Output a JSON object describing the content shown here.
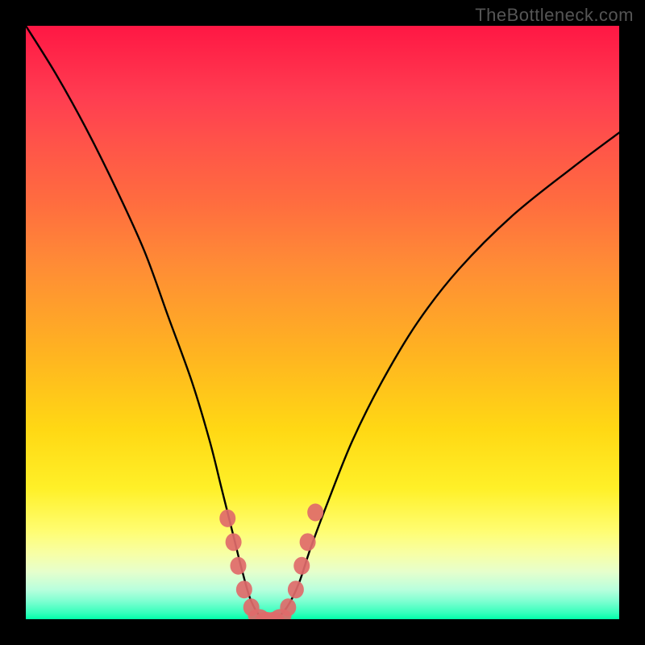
{
  "watermark": {
    "text": "TheBottleneck.com"
  },
  "chart_data": {
    "type": "line",
    "title": "",
    "xlabel": "",
    "ylabel": "",
    "xlim": [
      0,
      100
    ],
    "ylim": [
      0,
      100
    ],
    "legend": false,
    "grid": false,
    "background": "heatmap-gradient",
    "gradient_stops": [
      {
        "pos": 0.0,
        "color": "#ff1744"
      },
      {
        "pos": 0.2,
        "color": "#ff5449"
      },
      {
        "pos": 0.4,
        "color": "#ff8b36"
      },
      {
        "pos": 0.6,
        "color": "#ffc51c"
      },
      {
        "pos": 0.8,
        "color": "#fff44a"
      },
      {
        "pos": 0.93,
        "color": "#d9ffc8"
      },
      {
        "pos": 1.0,
        "color": "#00ffa8"
      }
    ],
    "series": [
      {
        "name": "bottleneck-curve",
        "stroke": "#000000",
        "x": [
          0,
          5,
          10,
          15,
          20,
          24,
          28,
          31,
          33,
          35,
          36.5,
          38,
          40,
          42,
          44,
          46,
          48,
          51,
          55,
          60,
          66,
          73,
          82,
          92,
          100
        ],
        "y": [
          100,
          92,
          83,
          73,
          62,
          51,
          40,
          30,
          22,
          14,
          8,
          3,
          0,
          0,
          2,
          6,
          12,
          20,
          30,
          40,
          50,
          59,
          68,
          76,
          82
        ]
      },
      {
        "name": "highlight-markers",
        "type": "scatter-blob",
        "fill": "#e06a6a",
        "points": [
          {
            "x": 34.0,
            "y": 17
          },
          {
            "x": 35.0,
            "y": 13
          },
          {
            "x": 35.8,
            "y": 9
          },
          {
            "x": 36.8,
            "y": 5
          },
          {
            "x": 38.0,
            "y": 2
          },
          {
            "x": 39.2,
            "y": 0.5
          },
          {
            "x": 40.5,
            "y": 0
          },
          {
            "x": 41.8,
            "y": 0
          },
          {
            "x": 43.0,
            "y": 0.5
          },
          {
            "x": 44.2,
            "y": 2
          },
          {
            "x": 45.5,
            "y": 5
          },
          {
            "x": 46.5,
            "y": 9
          },
          {
            "x": 47.5,
            "y": 13
          },
          {
            "x": 48.8,
            "y": 18
          }
        ]
      }
    ]
  }
}
